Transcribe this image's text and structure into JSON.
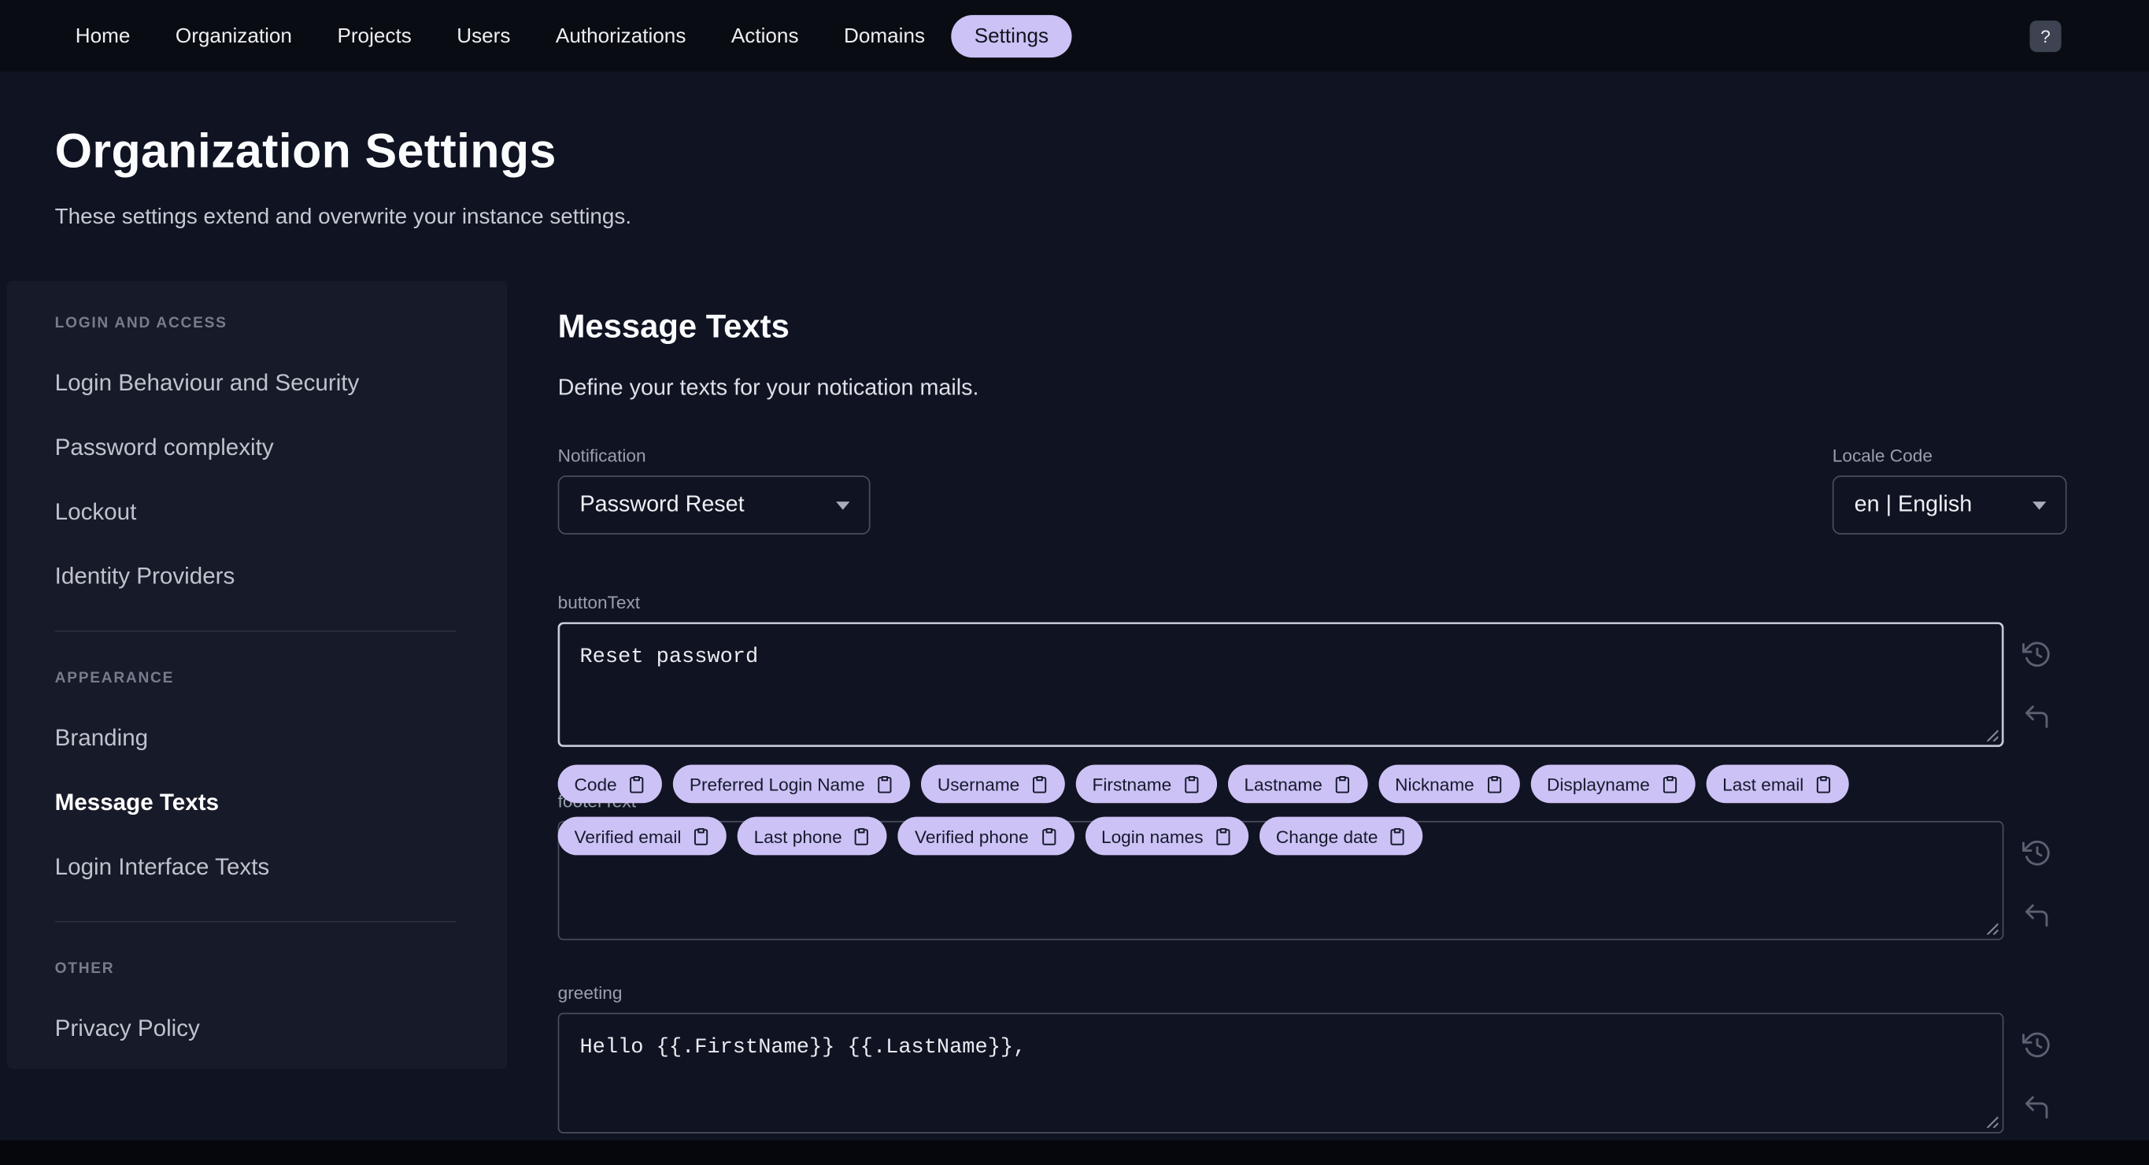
{
  "topnav": {
    "items": [
      "Home",
      "Organization",
      "Projects",
      "Users",
      "Authorizations",
      "Actions",
      "Domains",
      "Settings"
    ],
    "active_item": "Settings",
    "help_button": "?"
  },
  "header": {
    "title": "Organization Settings",
    "subtitle": "These settings extend and overwrite your instance settings."
  },
  "sidebar": {
    "sections": [
      {
        "title": "LOGIN AND ACCESS",
        "items": [
          "Login Behaviour and Security",
          "Password complexity",
          "Lockout",
          "Identity Providers"
        ]
      },
      {
        "title": "APPEARANCE",
        "items": [
          "Branding",
          "Message Texts",
          "Login Interface Texts"
        ]
      },
      {
        "title": "OTHER",
        "items": [
          "Privacy Policy"
        ]
      }
    ],
    "active_item": "Message Texts"
  },
  "main": {
    "title": "Message Texts",
    "subtitle": "Define your texts for your notication mails.",
    "notification": {
      "label": "Notification",
      "value": "Password Reset"
    },
    "locale": {
      "label": "Locale Code",
      "value": "en | English"
    },
    "fields": [
      {
        "label": "buttonText",
        "value": "Reset password"
      },
      {
        "label": "footerText",
        "value": ""
      },
      {
        "label": "greeting",
        "value": "Hello {{.FirstName}} {{.LastName}},"
      }
    ],
    "chips": [
      "Code",
      "Preferred Login Name",
      "Username",
      "Firstname",
      "Lastname",
      "Nickname",
      "Displayname",
      "Last email",
      "Verified email",
      "Last phone",
      "Verified phone",
      "Login names",
      "Change date"
    ]
  },
  "icons": {
    "help": "question-mark-icon",
    "select_caret": "chevron-down-icon",
    "field_history": "restore-icon",
    "field_undo": "undo-icon",
    "chip_copy": "copy-icon",
    "resize": "resize-handle-icon"
  },
  "colors": {
    "accent": "#ccc2f5",
    "background": "#101321",
    "topbar": "#0a0c13",
    "sidebar": "#171a28",
    "border": "#474d5e",
    "focus_border": "#d3d6e4"
  }
}
